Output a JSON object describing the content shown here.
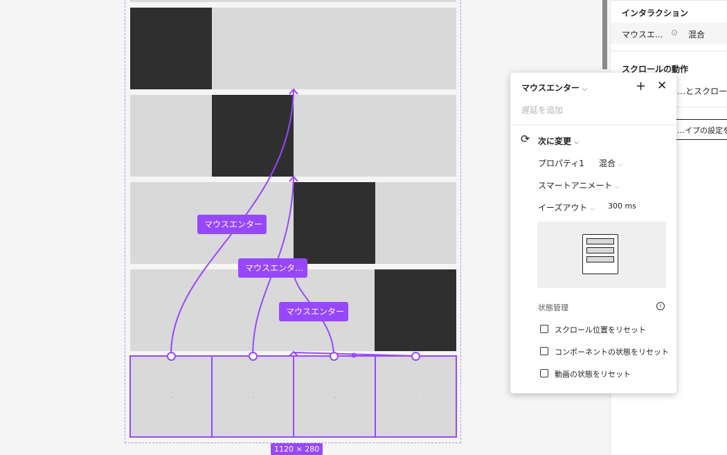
{
  "canvas": {
    "size_badge": "1120 × 280",
    "interaction_tags": [
      "マウスエンター",
      "マウスエンタ…",
      "マウスエンター"
    ]
  },
  "right_panel": {
    "interaction_heading": "インタラクション",
    "interaction_trigger": "マウスエ...",
    "interaction_value": "混合",
    "scroll_heading": "スクロールの動作",
    "scroll_value": "…とスクロール",
    "prototype_button": "…イプの設定を表示"
  },
  "popup": {
    "trigger": "マウスエンター",
    "add_delay": "遅延を追加",
    "action": "次に変更",
    "property_label": "プロパティ1",
    "property_value": "混合",
    "animation": "スマートアニメート",
    "easing": "イーズアウト",
    "duration": "300 ms",
    "state_heading": "状態管理",
    "checkboxes": [
      "スクロール位置をリセット",
      "コンポーネントの状態をリセット",
      "動画の状態をリセット"
    ]
  },
  "colors": {
    "accent": "#9747ff",
    "dark_block": "#2f2f2f",
    "row_fill": "#d9d9d9"
  }
}
